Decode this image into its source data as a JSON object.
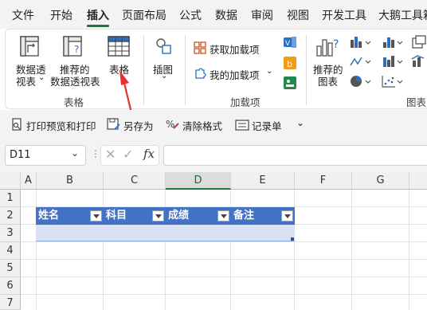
{
  "tabs": [
    "文件",
    "开始",
    "插入",
    "页面布局",
    "公式",
    "数据",
    "审阅",
    "视图",
    "开发工具",
    "大鹅工具箱"
  ],
  "ribbon": {
    "tables_group": {
      "label": "表格",
      "pivot_line1": "数据透",
      "pivot_line2": "视表",
      "recommended_line1": "推荐的",
      "recommended_line2": "数据透视表",
      "table": "表格"
    },
    "illustrations": {
      "label": "插图"
    },
    "addins_group": {
      "label": "加载项",
      "get_addins": "获取加载项",
      "my_addins": "我的加载项"
    },
    "charts_group": {
      "recommended_line1": "推荐的",
      "recommended_line2": "图表",
      "label": "图表"
    }
  },
  "quick_access": {
    "print_preview": "打印预览和打印",
    "save_as": "另存为",
    "clear_format": "清除格式",
    "record_macro": "记录单"
  },
  "formula_bar": {
    "name_box": "D11",
    "fx": "fx",
    "formula": ""
  },
  "grid": {
    "columns": [
      "A",
      "B",
      "C",
      "D",
      "E",
      "F",
      "G"
    ],
    "selected_column": "D",
    "rows": [
      "1",
      "2",
      "3",
      "4",
      "5",
      "6",
      "7"
    ]
  },
  "table": {
    "headers": [
      "姓名",
      "科目",
      "成绩",
      "备注"
    ],
    "header_color": "#4472c4",
    "band_color": "#d9e1f2"
  },
  "annotation": {
    "arrow_color": "#e8312f"
  }
}
